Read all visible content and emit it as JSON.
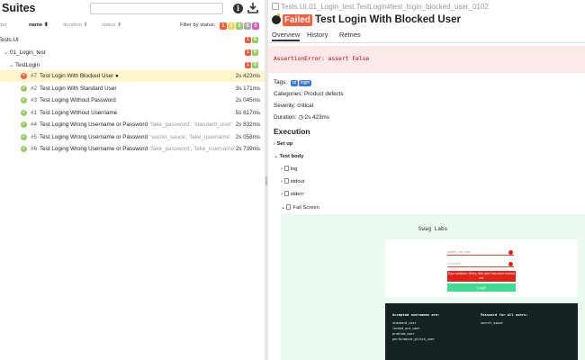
{
  "left": {
    "title": "Suites",
    "sort": {
      "order": "order",
      "name": "name",
      "duration": "duration",
      "status": "status",
      "filter_label": "Filter by status:",
      "filters": [
        {
          "value": "1",
          "color": "#fd5a3e"
        },
        {
          "value": "8",
          "color": "#ffd050"
        },
        {
          "value": "0",
          "color": "#97cc64"
        },
        {
          "value": "0",
          "color": "#aaaaaa"
        },
        {
          "value": "0",
          "color": "#d35ebe"
        }
      ]
    },
    "groups": [
      {
        "label": "Tests.UI",
        "failed": "1",
        "passed": "6",
        "indent": 0,
        "chevron": ""
      },
      {
        "label": "01_Login_test",
        "failed": "1",
        "passed": "6",
        "indent": 1,
        "chevron": "⌄"
      },
      {
        "label": "TestLogin",
        "failed": "1",
        "passed": "6",
        "indent": 2,
        "chevron": "⌄"
      }
    ],
    "tests": [
      {
        "num": "#7",
        "name": "Test Login With Blocked User",
        "params": "",
        "duration": "2s 423ms",
        "status": "failed",
        "selected": true
      },
      {
        "num": "#2",
        "name": "Test Login With Standard User",
        "params": "",
        "duration": "3s 171ms",
        "status": "passed"
      },
      {
        "num": "#3",
        "name": "Test Loging Without Password",
        "params": "",
        "duration": "2s 045ms",
        "status": "passed"
      },
      {
        "num": "#1",
        "name": "Test Loging Without Username",
        "params": "",
        "duration": "5s 817ms",
        "status": "passed"
      },
      {
        "num": "#4",
        "name": "Test Loging Wrong Username or Password",
        "params": "'fake_password', 'standard_user'",
        "duration": "2s 832ms",
        "status": "passed"
      },
      {
        "num": "#5",
        "name": "Test Loging Wrong Username or Password",
        "params": "'secret_sauce', 'fake_username'",
        "duration": "2s 058ms",
        "status": "passed"
      },
      {
        "num": "#6",
        "name": "Test Loging Wrong Username or Password",
        "params": "'fake_password', 'fake_username'",
        "duration": "2s 739ms",
        "status": "passed"
      }
    ]
  },
  "right": {
    "breadcrumb": "Tests.UI.01_Login_test.TestLogin#test_login_blocked_user_0102",
    "status_badge": "Failed",
    "test_title": "Test Login With Blocked User",
    "tabs": [
      "Overview",
      "History",
      "Retries"
    ],
    "error": "AssertionError: assert False",
    "tags_label": "Tags:",
    "tags": [
      "ui",
      "login"
    ],
    "categories": "Categories: Product defects",
    "severity": "Severity: critical",
    "duration_label": "Duration:",
    "duration_value": "2s 423ms",
    "execution": "Execution",
    "setup": "Set up",
    "test_body": "Test body",
    "steps": [
      "log",
      "stdout",
      "stderr",
      "Fail Screen"
    ],
    "screenshot": {
      "title": "Swag Labs",
      "username": "locked_out_user",
      "password": "••••••••••••",
      "error": "Epic sadface: Sorry, this user has been locked out.",
      "login": "Login",
      "accepted_header": "Accepted usernames are:",
      "usernames": [
        "standard_user",
        "locked_out_user",
        "problem_user",
        "performance_glitch_user"
      ],
      "password_header": "Password for all users:",
      "password_value": "secret_sauce"
    }
  }
}
